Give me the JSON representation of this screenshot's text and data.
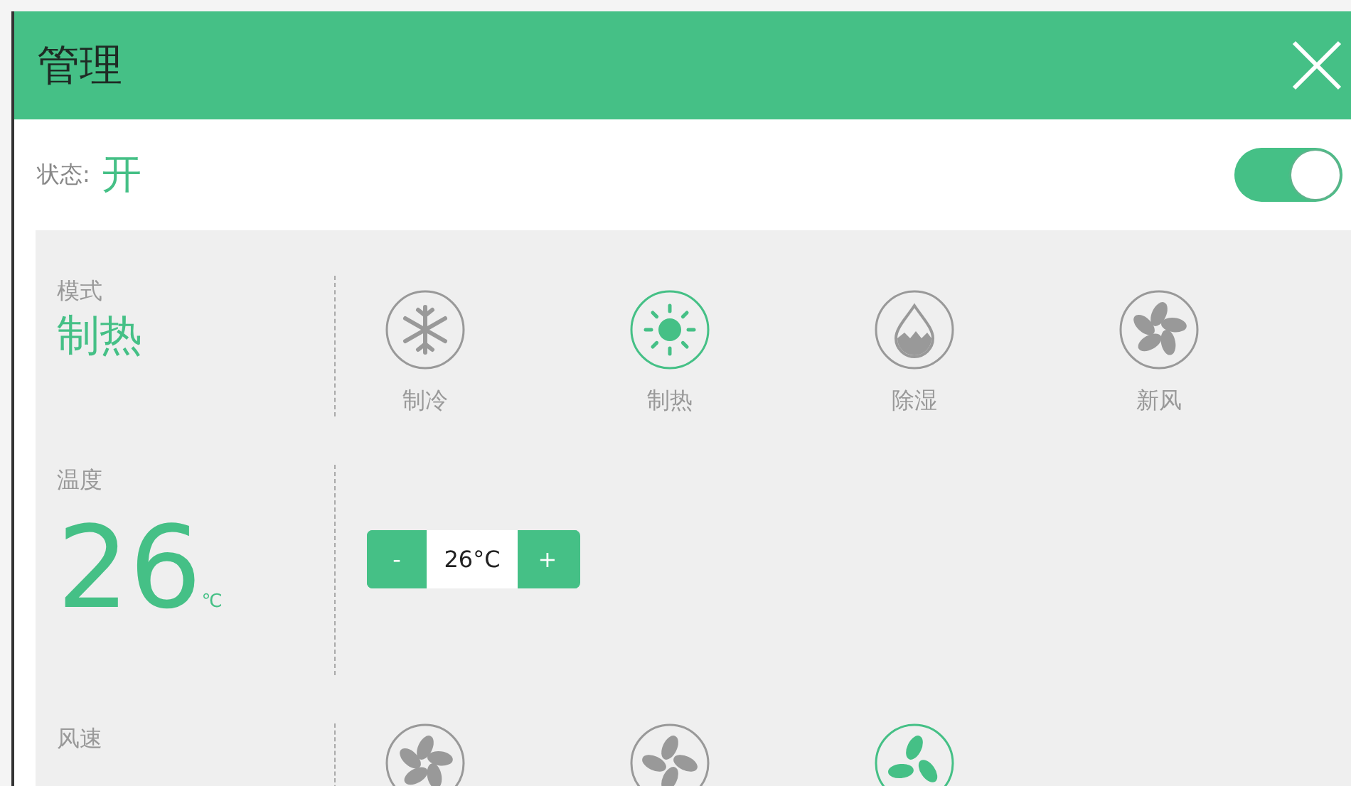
{
  "window": {
    "title": "管理"
  },
  "status": {
    "label": "状态:",
    "value": "开",
    "on": true
  },
  "mode": {
    "label": "模式",
    "value": "制热",
    "options": [
      {
        "kind": "snowflake",
        "label": "制冷",
        "selected": false
      },
      {
        "kind": "sun",
        "label": "制热",
        "selected": true
      },
      {
        "kind": "drop",
        "label": "除湿",
        "selected": false
      },
      {
        "kind": "pinwheel",
        "label": "新风",
        "selected": false
      }
    ]
  },
  "temperature": {
    "label": "温度",
    "value": "26",
    "unit": "℃",
    "minus": "-",
    "display": "26°C",
    "plus": "+"
  },
  "fan_speed": {
    "label": "风速",
    "options": [
      {
        "kind": "fan5",
        "selected": false
      },
      {
        "kind": "fan4",
        "selected": false
      },
      {
        "kind": "fan3",
        "selected": true
      }
    ]
  }
}
